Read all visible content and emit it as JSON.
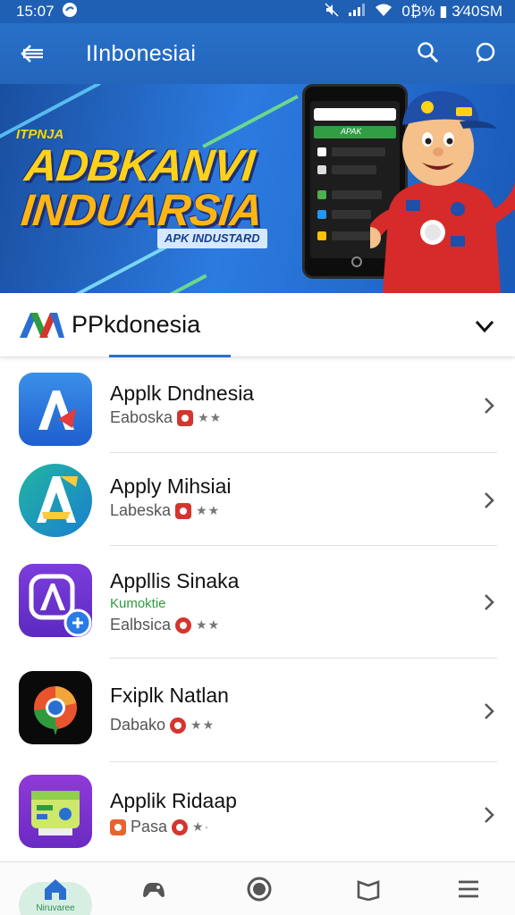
{
  "status_bar": {
    "time": "15:07",
    "right_text": "0₿% ▮ 3⁄40SM"
  },
  "app_bar": {
    "title": "IInbonesiai",
    "icons": [
      "back-arrow-icon",
      "search-icon",
      "chat-icon"
    ]
  },
  "banner": {
    "tag": "ITPNJA",
    "headline_1": "ADBKANVI",
    "headline_2": "INDUARSIA",
    "subtitle": "APK INDUSTARD",
    "phone_label": "APAK"
  },
  "section": {
    "name": "PPkdonesia"
  },
  "apps": [
    {
      "title": "Applk Dndnesia",
      "subtitle": "Eaboska",
      "extra": "",
      "stars": "★★",
      "icon": "app-a-blue"
    },
    {
      "title": "Apply Mihsiai",
      "subtitle": "Labeska",
      "extra": "",
      "stars": "★★",
      "icon": "app-a-teal"
    },
    {
      "title": "Appllis Sinaka",
      "subtitle": "Ealbsica",
      "extra": "Kumoktie",
      "stars": "★★",
      "icon": "app-a-purple"
    },
    {
      "title": "Fxiplk Natlan",
      "subtitle": "Dabako",
      "extra": "",
      "stars": "★★",
      "icon": "app-chrome-like"
    },
    {
      "title": "Applik Ridaap",
      "subtitle": "Pasa",
      "extra": "",
      "stars": "★·",
      "icon": "app-card-purple"
    }
  ],
  "bottom_nav": {
    "home_label": "Niruvaree",
    "items": [
      "home-icon",
      "games-icon",
      "apps-icon",
      "books-icon",
      "menu-icon"
    ]
  },
  "colors": {
    "primary": "#2466bb",
    "accent": "#2a6fd0",
    "badge": "#d6342f",
    "green": "#2e9b3e"
  }
}
